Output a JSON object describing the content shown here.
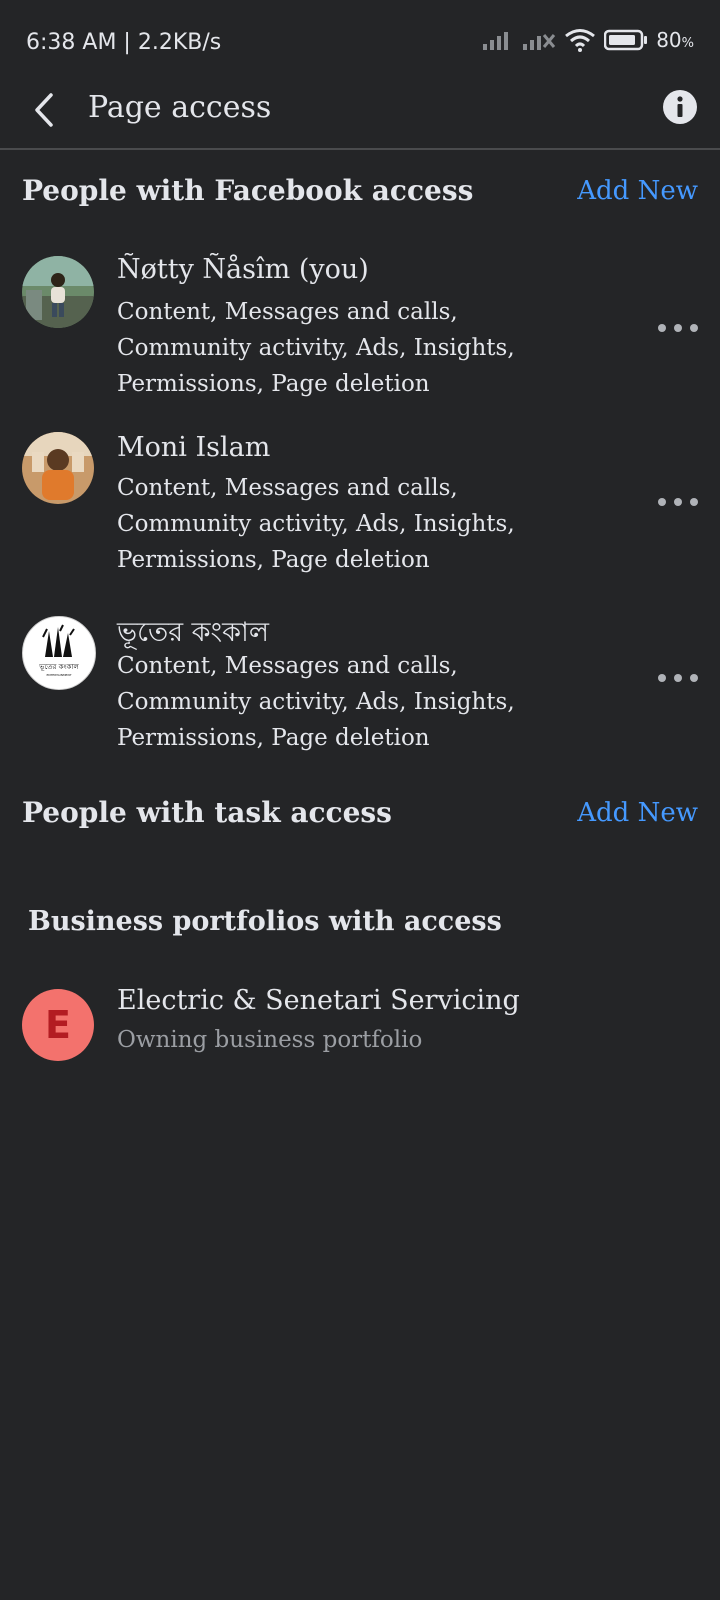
{
  "status_bar": {
    "time_speed": "6:38 AM | 2.2KB/s",
    "battery": "80",
    "battery_unit": "%"
  },
  "header": {
    "title": "Page access"
  },
  "facebook_access": {
    "title": "People with Facebook access",
    "add_label": "Add New",
    "people": [
      {
        "name": "Ñøtty Ñåsîm (you)",
        "permissions": "Content, Messages and calls, Community activity, Ads, Insights, Permissions, Page deletion"
      },
      {
        "name": "Moni Islam",
        "permissions": "Content, Messages and calls, Community activity, Ads, Insights, Permissions, Page deletion"
      },
      {
        "name": "ভূতের কংকাল",
        "permissions": "Content, Messages and calls, Community activity, Ads, Insights, Permissions, Page deletion",
        "avatar_text": "ভূতের কংকাল",
        "avatar_subtext": "ENTERTAINMENT"
      }
    ]
  },
  "task_access": {
    "title": "People with task access",
    "add_label": "Add New"
  },
  "business": {
    "title": "Business portfolios with access",
    "items": [
      {
        "initial": "E",
        "name": "Electric & Senetari Servicing",
        "subtitle": "Owning business portfolio"
      }
    ]
  },
  "colors": {
    "background": "#242527",
    "link": "#4599ff",
    "biz_avatar_bg": "#f3726d",
    "biz_avatar_fg": "#b31c22"
  }
}
